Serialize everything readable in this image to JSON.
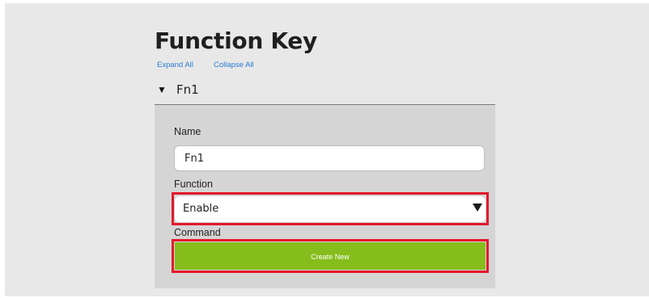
{
  "page": {
    "title": "Function Key",
    "expand_all": "Expand All",
    "collapse_all": "Collapse All"
  },
  "section": {
    "title": "Fn1",
    "expanded": true
  },
  "form": {
    "name_label": "Name",
    "name_value": "Fn1",
    "function_label": "Function",
    "function_value": "Enable",
    "command_label": "Command",
    "create_button_label": "Create New"
  },
  "colors": {
    "accent_green": "#85bd1c",
    "highlight_red": "#e3182d",
    "link_blue": "#2a7bd1"
  }
}
